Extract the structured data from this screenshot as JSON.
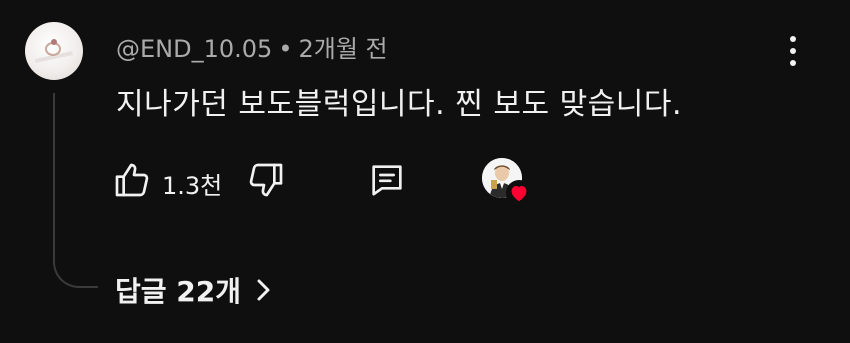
{
  "comment": {
    "author": "@END_10.05",
    "separator": "•",
    "time_ago": "2개월 전",
    "text": "지나가던 보도블럭입니다. 찐 보도 맞습니다.",
    "like_count": "1.3천"
  },
  "replies": {
    "label": "답글 22개"
  },
  "icons": {
    "avatar": "ring-photo-avatar",
    "more": "more-vertical-icon",
    "like": "thumbs-up-icon",
    "dislike": "thumbs-down-icon",
    "reply": "comment-bubble-icon",
    "creator_heart": "creator-heart-badge",
    "chevron": "chevron-right-icon"
  },
  "colors": {
    "background": "#0f0f0f",
    "text": "#f1f1f1",
    "muted": "#aaaaaa",
    "heart": "#ff0033",
    "thread_line": "#3a3a3a"
  }
}
